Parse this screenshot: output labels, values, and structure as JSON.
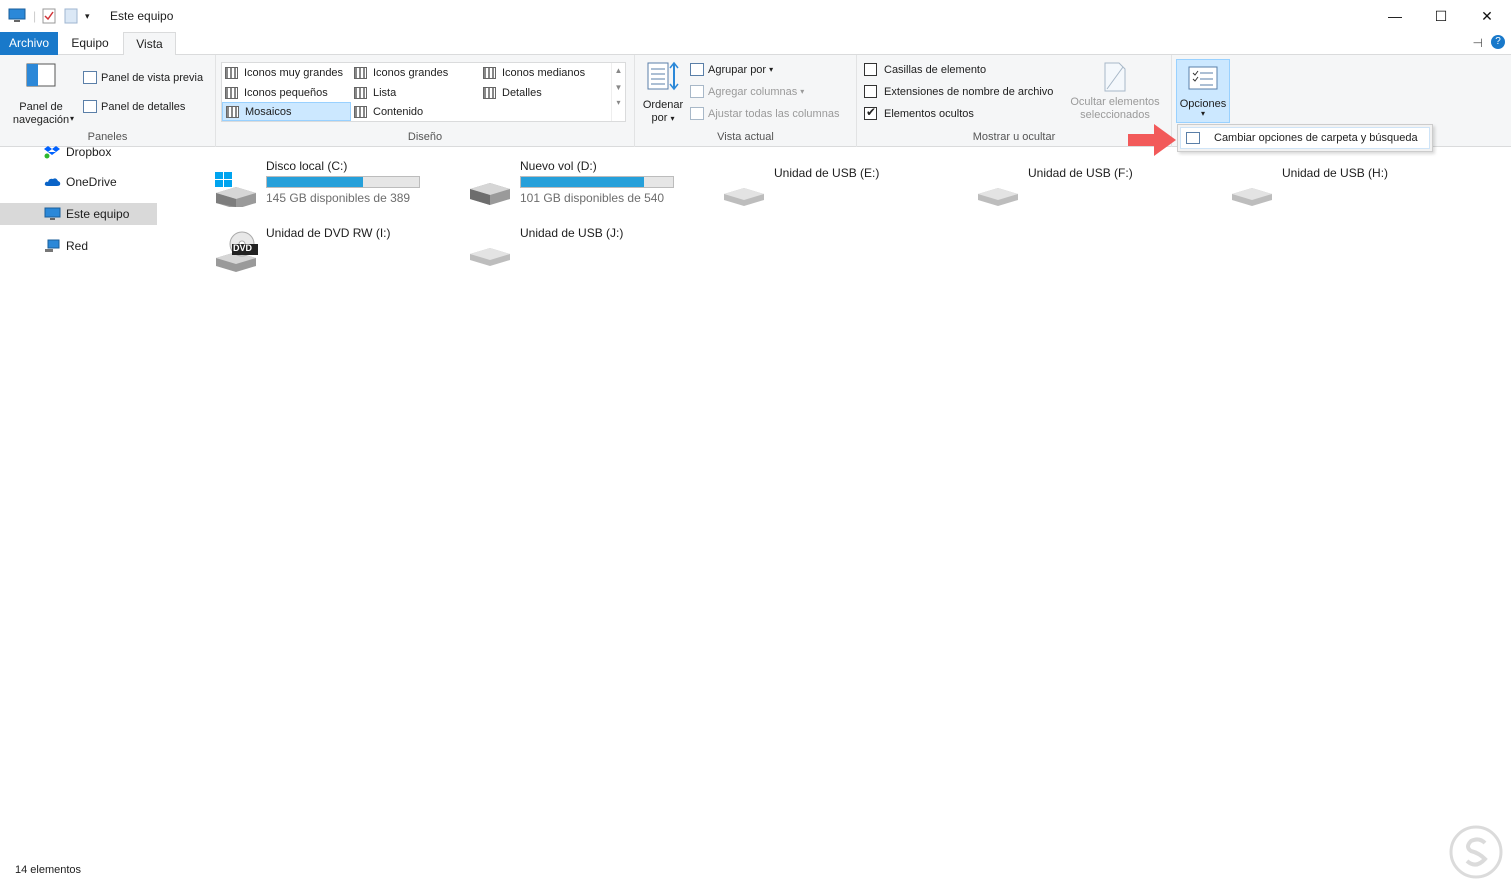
{
  "window": {
    "title": "Este equipo",
    "minimize": "—",
    "maximize": "☐",
    "close": "✕"
  },
  "tabs": [
    {
      "label": "Archivo"
    },
    {
      "label": "Equipo"
    },
    {
      "label": "Vista"
    }
  ],
  "ribbon": {
    "paneles": {
      "label": "Paneles",
      "nav_pane": "Panel de\nnavegación",
      "preview": "Panel de vista previa",
      "details": "Panel de detalles"
    },
    "diseno": {
      "label": "Diseño",
      "items": [
        "Iconos muy grandes",
        "Iconos grandes",
        "Iconos medianos",
        "Iconos pequeños",
        "Lista",
        "Detalles",
        "Mosaicos",
        "Contenido"
      ],
      "selected": "Mosaicos"
    },
    "vista_actual": {
      "label": "Vista actual",
      "sort": "Ordenar",
      "sort2": "por",
      "group": "Agrupar por",
      "add_cols": "Agregar columnas",
      "fit_cols": "Ajustar todas las columnas"
    },
    "mostrar": {
      "label": "Mostrar u ocultar",
      "checkboxes": [
        {
          "label": "Casillas de elemento",
          "checked": false
        },
        {
          "label": "Extensiones de nombre de archivo",
          "checked": false
        },
        {
          "label": "Elementos ocultos",
          "checked": true
        }
      ],
      "hide_selected_1": "Ocultar elementos",
      "hide_selected_2": "seleccionados"
    },
    "opciones": {
      "label": "Opciones",
      "dropdown_item": "Cambiar opciones de carpeta y búsqueda"
    }
  },
  "nav": {
    "items": [
      {
        "label": "Dropbox"
      },
      {
        "label": "OneDrive"
      },
      {
        "label": "Este equipo",
        "selected": true
      },
      {
        "label": "Red"
      }
    ]
  },
  "drives": [
    {
      "name": "Disco local (C:)",
      "free": "145 GB disponibles de 389",
      "used_fraction": 0.63,
      "icon": "windows-drive-icon"
    },
    {
      "name": "Nuevo vol (D:)",
      "free": "101 GB disponibles de 540",
      "used_fraction": 0.81,
      "icon": "hard-drive-icon"
    },
    {
      "name": "Unidad de USB (E:)",
      "icon": "usb-drive-icon"
    },
    {
      "name": "Unidad de USB (F:)",
      "icon": "usb-drive-icon"
    },
    {
      "name": "Unidad de USB (H:)",
      "icon": "usb-drive-icon"
    },
    {
      "name": "Unidad de DVD RW (I:)",
      "icon": "dvd-drive-icon",
      "badge": "DVD"
    },
    {
      "name": "Unidad de USB (J:)",
      "icon": "usb-drive-icon"
    }
  ],
  "status": {
    "count": "14 elementos"
  },
  "colors": {
    "accent": "#1979ca",
    "selection": "#cce8ff",
    "bar_fill": "#26a0da",
    "arrow": "#f25a5a"
  }
}
